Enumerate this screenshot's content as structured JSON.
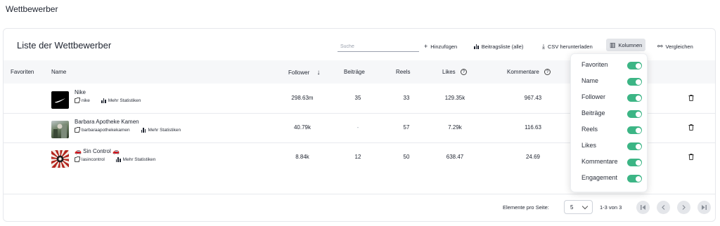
{
  "page": {
    "title": "Wettbewerber"
  },
  "card": {
    "title": "Liste der Wettbewerber",
    "search_placeholder": "Suche",
    "toolbar": {
      "add": "Hinzufügen",
      "post_list": "Beitragsliste (alle)",
      "csv": "CSV herunterladen",
      "columns": "Kolumnen",
      "compare": "Vergleichen"
    }
  },
  "table": {
    "headers": {
      "favorites": "Favoriten",
      "name": "Name",
      "followers": "Follower",
      "posts": "Beiträge",
      "reels": "Reels",
      "likes": "Likes",
      "comments": "Kommentare"
    },
    "rows": [
      {
        "name": "Nike",
        "handle": "nike",
        "stats_link": "Mehr Statistiken",
        "followers": "298.63m",
        "posts": "35",
        "reels": "33",
        "likes": "129.35k",
        "comments": "967.43"
      },
      {
        "name": "Barbara Apotheke Kamen",
        "handle": "barbaraapothekekamen",
        "stats_link": "Mehr Statistiken",
        "followers": "40.79k",
        "posts": "-",
        "reels": "57",
        "likes": "7.29k",
        "comments": "116.63"
      },
      {
        "name": "🚗 Sin Control 🚗",
        "handle": "lasincontrol",
        "stats_link": "Mehr Statistiken",
        "followers": "8.84k",
        "posts": "12",
        "reels": "50",
        "likes": "638.47",
        "comments": "24.69"
      }
    ]
  },
  "pagination": {
    "per_page_label": "Elemente pro Seite:",
    "per_page_value": "5",
    "range": "1-3 von 3"
  },
  "columns_menu": [
    {
      "label": "Favoriten",
      "enabled": true
    },
    {
      "label": "Name",
      "enabled": true
    },
    {
      "label": "Follower",
      "enabled": true
    },
    {
      "label": "Beiträge",
      "enabled": true
    },
    {
      "label": "Reels",
      "enabled": true
    },
    {
      "label": "Likes",
      "enabled": true
    },
    {
      "label": "Kommentare",
      "enabled": true
    },
    {
      "label": "Engagement",
      "enabled": true
    }
  ],
  "colors": {
    "toggle_on": "#3cb585",
    "toolbar_active": "#e3e5e9"
  }
}
